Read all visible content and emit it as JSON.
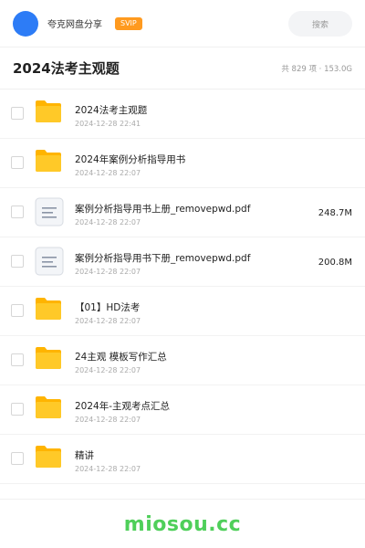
{
  "header": {
    "share_name": "夸克网盘分享",
    "badge": "SVIP",
    "search_label": "搜索"
  },
  "title_row": {
    "title": "2024法考主观题",
    "summary": "共 829 项 · 153.0G"
  },
  "files": [
    {
      "type": "folder",
      "name": "2024法考主观题",
      "date": "2024-12-28 22:41",
      "size": ""
    },
    {
      "type": "folder",
      "name": "2024年案例分析指导用书",
      "date": "2024-12-28 22:07",
      "size": ""
    },
    {
      "type": "file",
      "name": "案例分析指导用书上册_removepwd.pdf",
      "date": "2024-12-28 22:07",
      "size": "248.7M"
    },
    {
      "type": "file",
      "name": "案例分析指导用书下册_removepwd.pdf",
      "date": "2024-12-28 22:07",
      "size": "200.8M"
    },
    {
      "type": "folder",
      "name": "【01】HD法考",
      "date": "2024-12-28 22:07",
      "size": ""
    },
    {
      "type": "folder",
      "name": "24主观 模板写作汇总",
      "date": "2024-12-28 22:07",
      "size": ""
    },
    {
      "type": "folder",
      "name": "2024年-主观考点汇总",
      "date": "2024-12-28 22:07",
      "size": ""
    },
    {
      "type": "folder",
      "name": "精讲",
      "date": "2024-12-28 22:07",
      "size": ""
    }
  ],
  "watermark": "miosou.cc",
  "colors": {
    "accent": "#2d7cf6",
    "svip": "#ff9a1f",
    "folder": "#ffc928",
    "watermark": "#4fcf5a"
  }
}
